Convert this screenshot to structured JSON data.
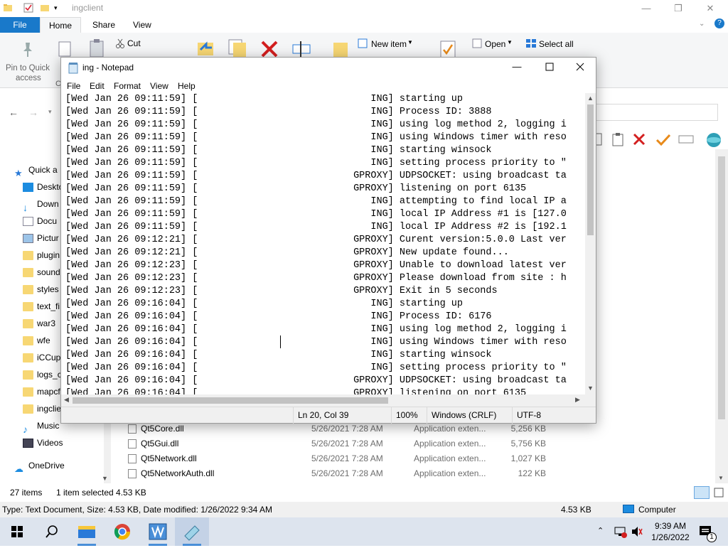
{
  "explorer": {
    "title": "ingclient",
    "tabs": [
      "File",
      "Home",
      "Share",
      "View"
    ],
    "ribbon": {
      "pin_label_1": "Pin to Quick",
      "pin_label_2": "access",
      "cut_label": "Cut",
      "new_item_label": "New item",
      "open_label": "Open",
      "select_all_label": "Select all"
    },
    "nav_items": [
      {
        "label": "Quick a",
        "icon": "star-icon"
      },
      {
        "label": "Deskto",
        "icon": "desktop-icon"
      },
      {
        "label": "Down",
        "icon": "download-icon"
      },
      {
        "label": "Docu",
        "icon": "document-icon"
      },
      {
        "label": "Pictur",
        "icon": "pictures-icon"
      },
      {
        "label": "plugin",
        "icon": "folder-icon"
      },
      {
        "label": "sound",
        "icon": "folder-icon"
      },
      {
        "label": "styles",
        "icon": "folder-icon"
      },
      {
        "label": "text_fi",
        "icon": "folder-icon"
      },
      {
        "label": "war3",
        "icon": "folder-icon"
      },
      {
        "label": "wfe",
        "icon": "folder-icon"
      },
      {
        "label": "iCCup",
        "icon": "folder-icon"
      },
      {
        "label": "logs_c",
        "icon": "folder-icon"
      },
      {
        "label": "mapcf",
        "icon": "folder-icon"
      },
      {
        "label": "ingclie",
        "icon": "folder-icon"
      },
      {
        "label": "Music",
        "icon": "music-icon"
      },
      {
        "label": "Videos",
        "icon": "videos-icon"
      },
      {
        "label": "OneDrive",
        "icon": "cloud-icon"
      }
    ],
    "files": [
      {
        "name": "Qt5Core.dll",
        "date": "5/26/2021 7:28 AM",
        "type": "Application exten...",
        "size": "5,256 KB"
      },
      {
        "name": "Qt5Gui.dll",
        "date": "5/26/2021 7:28 AM",
        "type": "Application exten...",
        "size": "5,756 KB"
      },
      {
        "name": "Qt5Network.dll",
        "date": "5/26/2021 7:28 AM",
        "type": "Application exten...",
        "size": "1,027 KB"
      },
      {
        "name": "Qt5NetworkAuth.dll",
        "date": "5/26/2021 7:28 AM",
        "type": "Application exten...",
        "size": "122 KB"
      }
    ],
    "status_count": "27 items",
    "status_selected": "1 item selected  4.53 KB",
    "info_text": "Type: Text Document, Size: 4.53 KB, Date modified: 1/26/2022 9:34 AM",
    "info_size": "4.53 KB",
    "info_location": "Computer"
  },
  "notepad": {
    "title": "ing - Notepad",
    "menu": [
      "File",
      "Edit",
      "Format",
      "View",
      "Help"
    ],
    "lines": [
      "[Wed Jan 26 09:11:59] [                              ING] starting up",
      "[Wed Jan 26 09:11:59] [                              ING] Process ID: 3888",
      "[Wed Jan 26 09:11:59] [                              ING] using log method 2, logging i",
      "[Wed Jan 26 09:11:59] [                              ING] using Windows timer with reso",
      "[Wed Jan 26 09:11:59] [                              ING] starting winsock",
      "[Wed Jan 26 09:11:59] [                              ING] setting process priority to \"",
      "[Wed Jan 26 09:11:59] [                           GPROXY] UDPSOCKET: using broadcast ta",
      "[Wed Jan 26 09:11:59] [                           GPROXY] listening on port 6135",
      "[Wed Jan 26 09:11:59] [                              ING] attempting to find local IP a",
      "[Wed Jan 26 09:11:59] [                              ING] local IP Address #1 is [127.0",
      "[Wed Jan 26 09:11:59] [                              ING] local IP Address #2 is [192.1",
      "[Wed Jan 26 09:12:21] [                           GPROXY] Curent version:5.0.0 Last ver",
      "[Wed Jan 26 09:12:21] [                           GPROXY] New update found...",
      "[Wed Jan 26 09:12:23] [                           GPROXY] Unable to download latest ver",
      "[Wed Jan 26 09:12:23] [                           GPROXY] Please download from site : h",
      "[Wed Jan 26 09:12:23] [                           GPROXY] Exit in 5 seconds",
      "[Wed Jan 26 09:16:04] [                              ING] starting up",
      "[Wed Jan 26 09:16:04] [                              ING] Process ID: 6176",
      "[Wed Jan 26 09:16:04] [                              ING] using log method 2, logging i",
      "[Wed Jan 26 09:16:04] [                              ING] using Windows timer with reso",
      "[Wed Jan 26 09:16:04] [                              ING] starting winsock",
      "[Wed Jan 26 09:16:04] [                              ING] setting process priority to \"",
      "[Wed Jan 26 09:16:04] [                           GPROXY] UDPSOCKET: using broadcast ta",
      "[Wed Jan 26 09:16:04] [                           GPROXY] listening on port 6135"
    ],
    "status_pos": "Ln 20, Col 39",
    "status_zoom": "100%",
    "status_eol": "Windows (CRLF)",
    "status_enc": "UTF-8"
  },
  "taskbar": {
    "time": "9:39 AM",
    "date": "1/26/2022",
    "notification_count": "1"
  }
}
